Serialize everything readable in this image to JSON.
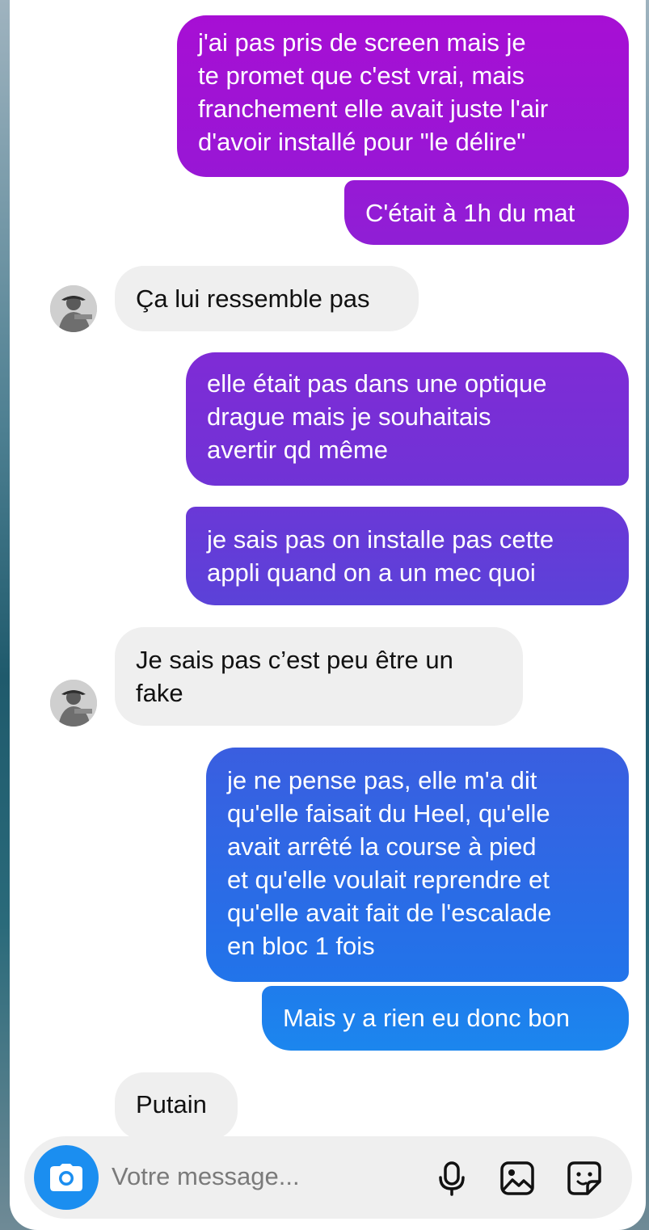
{
  "messages": [
    {
      "dir": "out",
      "text": "j'ai pas pris de screen mais je\nte promet que c'est vrai, mais\nfranchement elle avait juste l'air\nd'avoir installé pour \"le délire\""
    },
    {
      "dir": "out",
      "text": "C'était à 1h du mat"
    },
    {
      "dir": "in",
      "text": "Ça lui ressemble pas"
    },
    {
      "dir": "out",
      "text": "elle était pas dans une optique\ndrague mais je souhaitais\navertir qd même"
    },
    {
      "dir": "out",
      "text": "je sais pas on installe pas cette\nappli quand on a un mec quoi"
    },
    {
      "dir": "in",
      "text": "Je sais pas c’est peu être un\nfake"
    },
    {
      "dir": "out",
      "text": "je ne pense pas, elle m'a dit\nqu'elle faisait du Heel, qu'elle\navait arrêté la course à pied\net qu'elle voulait reprendre et\nqu'elle avait fait de l'escalade\nen bloc 1 fois"
    },
    {
      "dir": "out",
      "text": "Mais y a rien eu donc bon"
    },
    {
      "dir": "in",
      "text": "Putain"
    }
  ],
  "composer": {
    "placeholder": "Votre message...",
    "icons": [
      "camera-icon",
      "microphone-icon",
      "gallery-icon",
      "sticker-icon"
    ]
  },
  "colors": {
    "outgoing_top": "#a410d4",
    "outgoing_bottom": "#1c86ee",
    "incoming": "#efefef",
    "camera_button": "#1b8ef0"
  }
}
